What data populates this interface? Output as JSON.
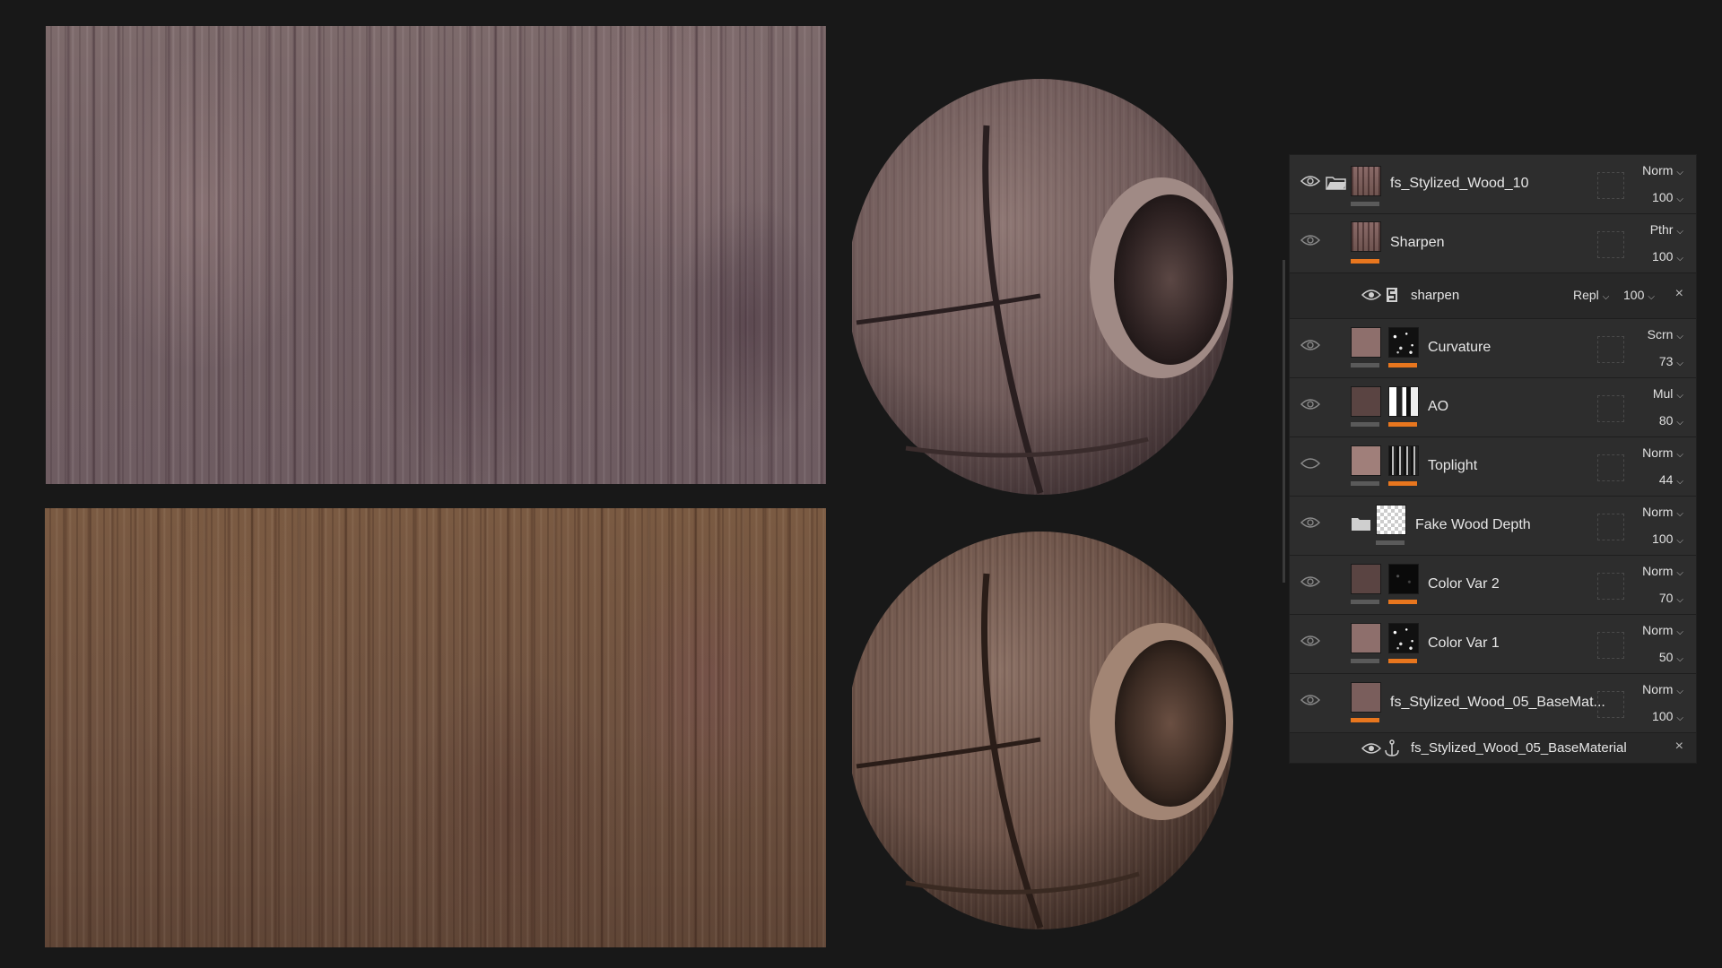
{
  "layers": [
    {
      "name": "fs_Stylized_Wood_10",
      "blend": "Norm",
      "opacity": "100",
      "type": "folder"
    },
    {
      "name": "Sharpen",
      "blend": "Pthr",
      "opacity": "100",
      "type": "filter"
    },
    {
      "sub_name": "sharpen",
      "sub_blend": "Repl",
      "sub_opacity": "100",
      "type": "effect"
    },
    {
      "name": "Curvature",
      "blend": "Scrn",
      "opacity": "73",
      "type": "fill"
    },
    {
      "name": "AO",
      "blend": "Mul",
      "opacity": "80",
      "type": "fill"
    },
    {
      "name": "Toplight",
      "blend": "Norm",
      "opacity": "44",
      "type": "fill"
    },
    {
      "name": "Fake Wood Depth",
      "blend": "Norm",
      "opacity": "100",
      "type": "folder"
    },
    {
      "name": "Color Var 2",
      "blend": "Norm",
      "opacity": "70",
      "type": "fill"
    },
    {
      "name": "Color Var 1",
      "blend": "Norm",
      "opacity": "50",
      "type": "fill"
    },
    {
      "name": "fs_Stylized_Wood_05_BaseMat...",
      "blend": "Norm",
      "opacity": "100",
      "type": "fill"
    },
    {
      "sub_name": "fs_Stylized_Wood_05_BaseMaterial",
      "type": "anchor"
    }
  ],
  "icons": {
    "eye": "eye-icon",
    "folder": "folder-icon",
    "close": "close-icon",
    "anchor": "anchor-icon",
    "sharpen": "sharpen-icon",
    "chevron": "chevron-down-icon"
  },
  "colors": {
    "accent": "#e8761e",
    "panel_bg": "#2b2b2b",
    "background": "#181818"
  }
}
